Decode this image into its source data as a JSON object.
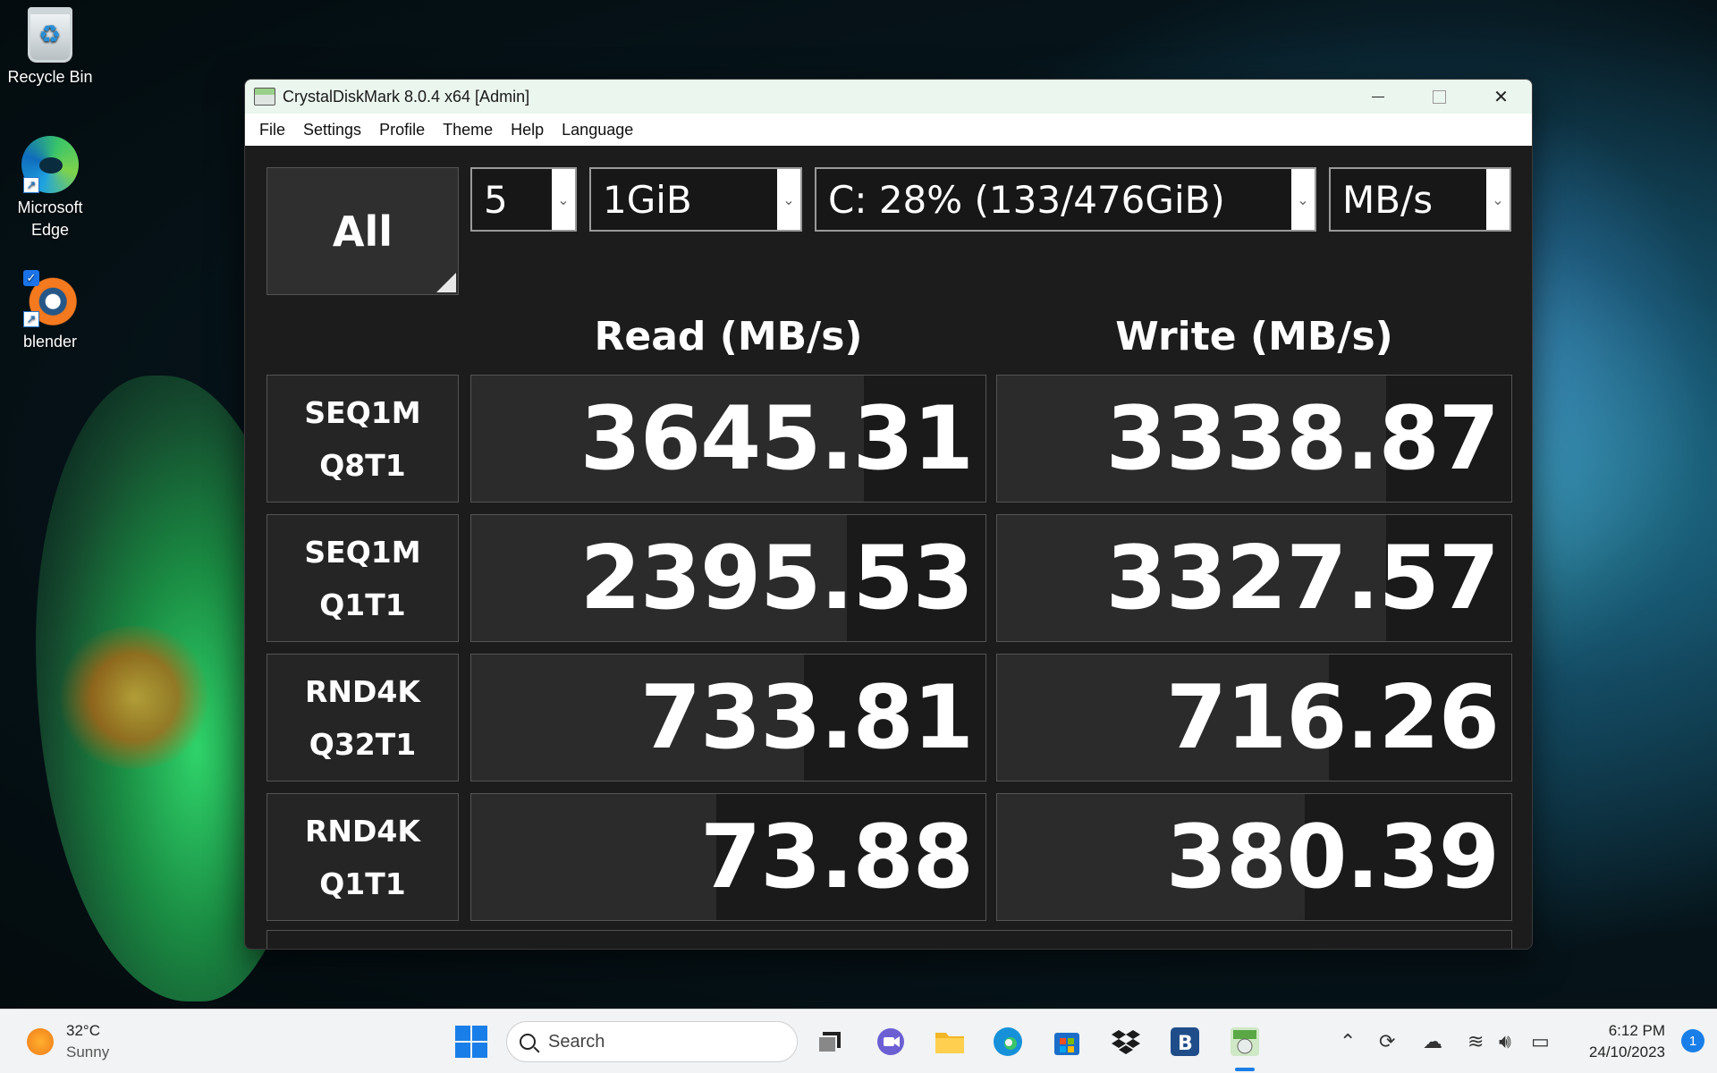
{
  "desktop": {
    "icons": [
      {
        "label": "Recycle Bin",
        "icon": "recycle-bin-icon"
      },
      {
        "label": "Microsoft Edge",
        "icon": "edge-icon"
      },
      {
        "label": "blender",
        "icon": "blender-icon"
      }
    ]
  },
  "window": {
    "title": "CrystalDiskMark 8.0.4 x64 [Admin]",
    "menu": [
      "File",
      "Settings",
      "Profile",
      "Theme",
      "Help",
      "Language"
    ]
  },
  "controls": {
    "all_label": "All",
    "count": "5",
    "size": "1GiB",
    "drive": "C: 28% (133/476GiB)",
    "unit": "MB/s"
  },
  "headers": {
    "read": "Read (MB/s)",
    "write": "Write (MB/s)"
  },
  "tests": [
    {
      "line1": "SEQ1M",
      "line2": "Q8T1",
      "read": "3645.31",
      "write": "3338.87",
      "read_fill": 0.764,
      "write_fill": 0.756
    },
    {
      "line1": "SEQ1M",
      "line2": "Q1T1",
      "read": "2395.53",
      "write": "3327.57",
      "read_fill": 0.731,
      "write_fill": 0.756
    },
    {
      "line1": "RND4K",
      "line2": "Q32T1",
      "read": "733.81",
      "write": "716.26",
      "read_fill": 0.647,
      "write_fill": 0.645
    },
    {
      "line1": "RND4K",
      "line2": "Q1T1",
      "read": "73.88",
      "write": "380.39",
      "read_fill": 0.477,
      "write_fill": 0.599
    }
  ],
  "colors": {
    "panel": "#1c1c1c",
    "bar": "#2b2b2b",
    "border": "#545454",
    "accent": "#1a7ee8"
  },
  "taskbar": {
    "weather_temp": "32°C",
    "weather_cond": "Sunny",
    "search_placeholder": "Search",
    "time": "6:12 PM",
    "date": "24/10/2023",
    "notifications": "1"
  }
}
